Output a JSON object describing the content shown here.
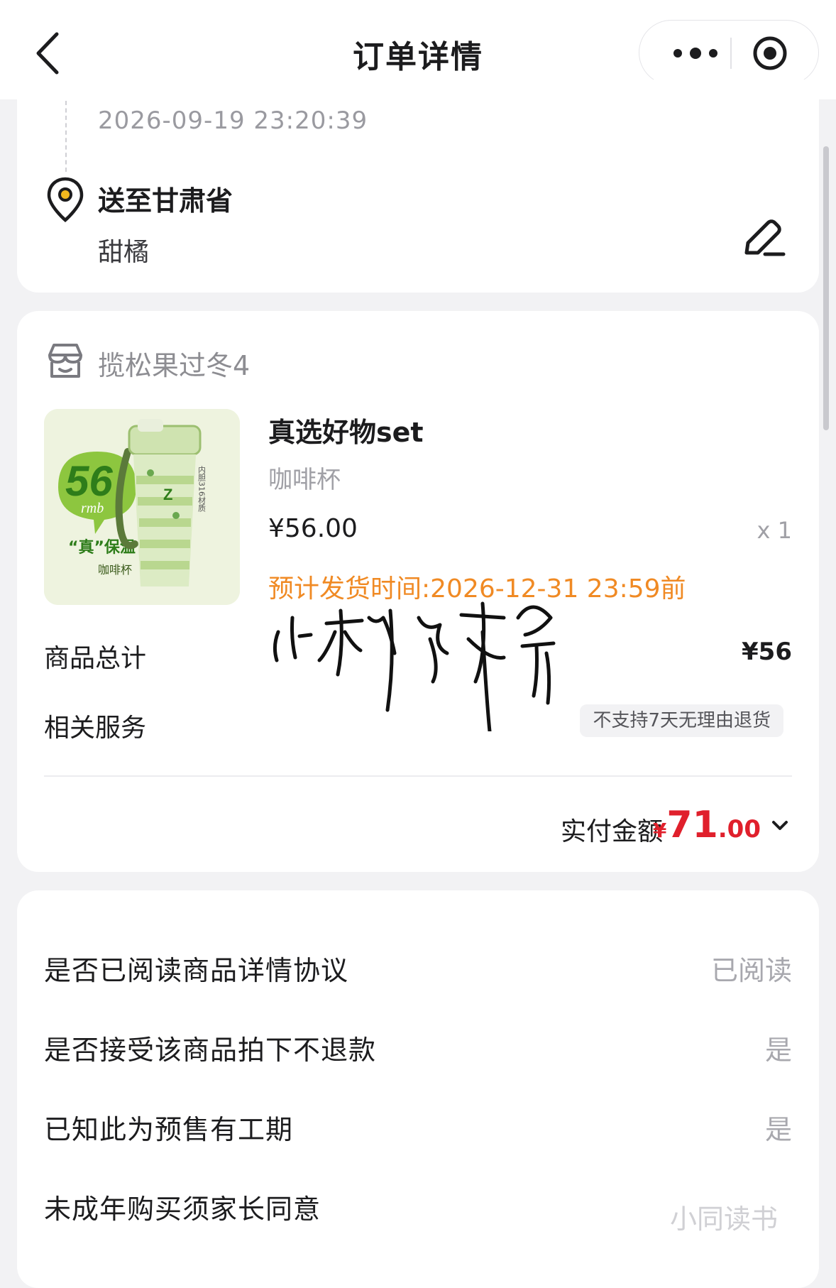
{
  "header": {
    "title": "订单详情",
    "back_icon": "chevron-left-icon",
    "more_icon": "more-dots-icon",
    "target_icon": "target-icon"
  },
  "address": {
    "timestamp": "2026-09-19 23:20:39",
    "ship_to": "送至甘肃省",
    "recipient": "甜橘",
    "edit_icon": "edit-pen-icon"
  },
  "order": {
    "shop_name": "揽松果过冬4",
    "product": {
      "name": "真选好物set",
      "spec": "咖啡杯",
      "price": "¥56.00",
      "quantity": "x 1",
      "ship_time": "预计发货时间:2026-12-31 23:59前",
      "image_badge": "56",
      "image_badge_unit": "rmb",
      "image_caption": "“真”保温",
      "image_caption2": "咖啡杯",
      "image_side": "内胆316材质"
    },
    "subtotal_label": "商品总计",
    "subtotal_value": "¥56",
    "service_label": "相关服务",
    "service_badge": "不支持7天无理由退货",
    "paid_label": "实付金额",
    "paid_currency": "¥",
    "paid_int": "71",
    "paid_dec": ".00",
    "signature_text": "小树维我命"
  },
  "agreements": [
    {
      "label": "是否已阅读商品详情协议",
      "value": "已阅读"
    },
    {
      "label": "是否接受该商品拍下不退款",
      "value": "是"
    },
    {
      "label": "已知此为预售有工期",
      "value": "是"
    },
    {
      "label": "未成年购买须家长同意",
      "value": ""
    }
  ],
  "watermark": "小同读书",
  "colors": {
    "accent_red": "#e0202c",
    "ship_orange": "#f08a24",
    "background": "#f2f2f4"
  }
}
